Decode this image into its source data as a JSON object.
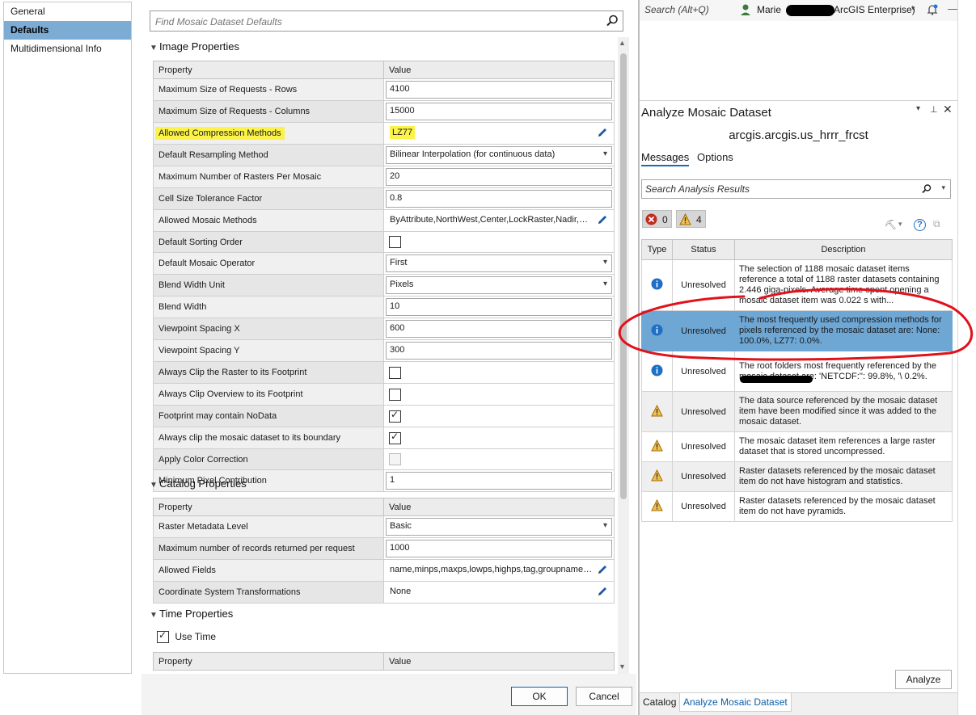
{
  "nav": {
    "items": [
      {
        "label": "General",
        "selected": false
      },
      {
        "label": "Defaults",
        "selected": true
      },
      {
        "label": "Multidimensional Info",
        "selected": false
      }
    ]
  },
  "find": {
    "placeholder": "Find Mosaic Dataset Defaults"
  },
  "image_properties": {
    "title": "Image Properties",
    "header": {
      "property": "Property",
      "value": "Value"
    },
    "rows": [
      {
        "label": "Maximum Size of Requests - Rows",
        "value": "4100"
      },
      {
        "label": "Maximum Size of Requests - Columns",
        "value": "15000"
      },
      {
        "label": "Allowed Compression Methods",
        "value": "LZ77"
      },
      {
        "label": "Default Resampling Method",
        "value": "Bilinear Interpolation (for continuous data)"
      },
      {
        "label": "Maximum Number of Rasters Per Mosaic",
        "value": "20"
      },
      {
        "label": "Cell Size Tolerance Factor",
        "value": "0.8"
      },
      {
        "label": "Allowed Mosaic Methods",
        "value": "ByAttribute,NorthWest,Center,LockRaster,Nadir,Seamline,None"
      },
      {
        "label": "Default Sorting Order",
        "value": ""
      },
      {
        "label": "Default Mosaic Operator",
        "value": "First"
      },
      {
        "label": "Blend Width Unit",
        "value": "Pixels"
      },
      {
        "label": "Blend Width",
        "value": "10"
      },
      {
        "label": "Viewpoint Spacing X",
        "value": "600"
      },
      {
        "label": "Viewpoint Spacing Y",
        "value": "300"
      },
      {
        "label": "Always Clip the Raster to its Footprint",
        "value": ""
      },
      {
        "label": "Always Clip Overview to its Footprint",
        "value": ""
      },
      {
        "label": "Footprint may contain NoData",
        "value": ""
      },
      {
        "label": "Always clip the mosaic dataset to its boundary",
        "value": ""
      },
      {
        "label": "Apply Color Correction",
        "value": ""
      },
      {
        "label": "Minimum Pixel Contribution",
        "value": "1"
      }
    ]
  },
  "catalog_properties": {
    "title": "Catalog Properties",
    "header": {
      "property": "Property",
      "value": "Value"
    },
    "rows": [
      {
        "label": "Raster Metadata Level",
        "value": "Basic"
      },
      {
        "label": "Maximum number of records returned per request",
        "value": "1000"
      },
      {
        "label": "Allowed Fields",
        "value": "name,minps,maxps,lowps,highps,tag,groupname,productname"
      },
      {
        "label": "Coordinate System Transformations",
        "value": "None"
      }
    ]
  },
  "time_properties": {
    "title": "Time Properties",
    "use_time_label": "Use Time",
    "header": {
      "property": "Property",
      "value": "Value"
    }
  },
  "buttons": {
    "ok": "OK",
    "cancel": "Cancel",
    "analyze": "Analyze"
  },
  "topbar": {
    "search_placeholder": "Search (Alt+Q)",
    "user_name": "Marie",
    "portal": "ArcGIS Enterprise)"
  },
  "analyze_panel": {
    "title": "Analyze Mosaic Dataset",
    "dataset_name": "arcgis.arcgis.us_hrrr_frcst",
    "tabs": {
      "messages": "Messages",
      "options": "Options"
    },
    "search_placeholder": "Search Analysis Results",
    "error_count": "0",
    "warning_count": "4",
    "columns": {
      "type": "Type",
      "status": "Status",
      "description": "Description"
    },
    "rows": [
      {
        "type": "info",
        "status": "Unresolved",
        "description": "The selection of 1188 mosaic dataset items reference a total of 1188 raster datasets containing 2.446 giga-pixels. Average time spent opening a mosaic dataset item was 0.022 s with..."
      },
      {
        "type": "info",
        "status": "Unresolved",
        "description": "The most frequently used compression methods for pixels referenced by the mosaic dataset are: None: 100.0%, LZ77: 0.0%."
      },
      {
        "type": "info",
        "status": "Unresolved",
        "description": "The root folders most frequently referenced by the mosaic dataset are: 'NETCDF:'': 99.8%, '\\ 0.2%."
      },
      {
        "type": "warning",
        "status": "Unresolved",
        "description": "The data source referenced by the mosaic dataset item have been modified since it was added to the mosaic dataset."
      },
      {
        "type": "warning",
        "status": "Unresolved",
        "description": "The mosaic dataset item references a large raster dataset that is stored uncompressed."
      },
      {
        "type": "warning",
        "status": "Unresolved",
        "description": "Raster datasets referenced by the mosaic dataset item do not have histogram and statistics."
      },
      {
        "type": "warning",
        "status": "Unresolved",
        "description": "Raster datasets referenced by the mosaic dataset item do not have pyramids."
      }
    ]
  },
  "bottom_tabs": {
    "catalog": "Catalog",
    "analyze": "Analyze Mosaic Dataset"
  },
  "colors": {
    "selected_row": "#6ea6d4",
    "highlight": "#fbf24a",
    "annotation_circle": "#e0121b",
    "accent": "#0a5fa8"
  }
}
